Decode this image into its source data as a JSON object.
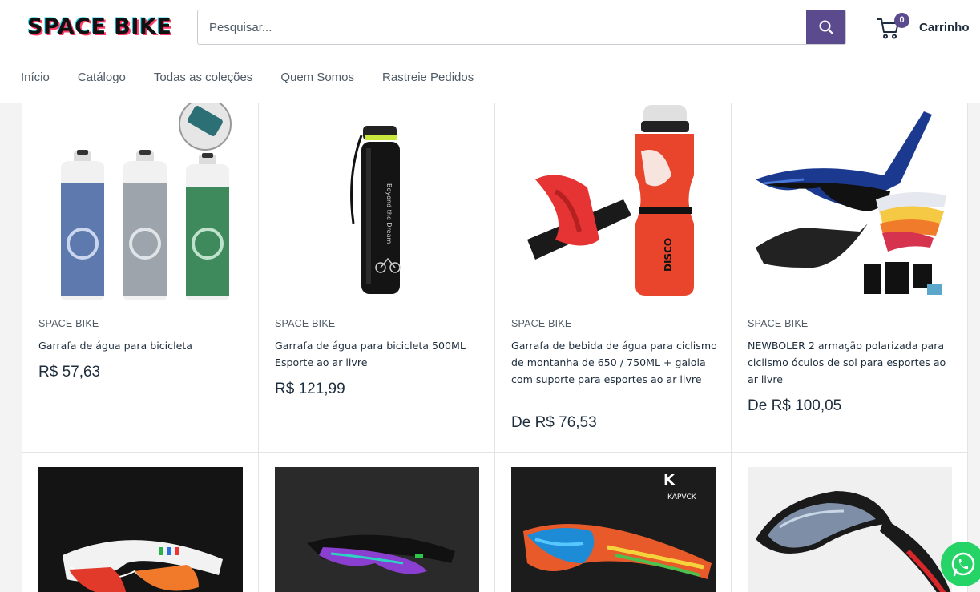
{
  "brand": {
    "logo_text": "SPACE BIKE"
  },
  "search": {
    "placeholder": "Pesquisar..."
  },
  "cart": {
    "count": "0",
    "label": "Carrinho"
  },
  "nav": {
    "items": [
      "Início",
      "Catálogo",
      "Todas as coleções",
      "Quem Somos",
      "Rastreie Pedidos"
    ]
  },
  "products": [
    {
      "vendor": "SPACE BIKE",
      "title": "Garrafa de água para bicicleta",
      "price": "R$ 57,63",
      "image": "three-bottles"
    },
    {
      "vendor": "SPACE BIKE",
      "title": "Garrafa de água para bicicleta 500ML Esporte ao ar livre",
      "price": "R$ 121,99",
      "image": "black-flask"
    },
    {
      "vendor": "SPACE BIKE",
      "title": "Garrafa de bebida de água para ciclismo de montanha de 650 / 750ML + gaiola com suporte para esportes ao ar livre",
      "price": "De R$ 76,53",
      "image": "red-bottle-cage"
    },
    {
      "vendor": "SPACE BIKE",
      "title": "NEWBOLER 2 armação polarizada para ciclismo óculos de sol para esportes ao ar livre",
      "price": "De R$ 100,05",
      "image": "blue-sunglasses-kit"
    }
  ],
  "bottom_products": [
    {
      "image": "white-sport-glasses"
    },
    {
      "image": "black-visor-glasses"
    },
    {
      "image": "colorful-glasses",
      "logo_text": "KAPVCK"
    },
    {
      "image": "black-red-glasses"
    }
  ],
  "colors": {
    "accent": "#5c4a8f",
    "whatsapp": "#25d366",
    "text": "#1e2d3d"
  }
}
